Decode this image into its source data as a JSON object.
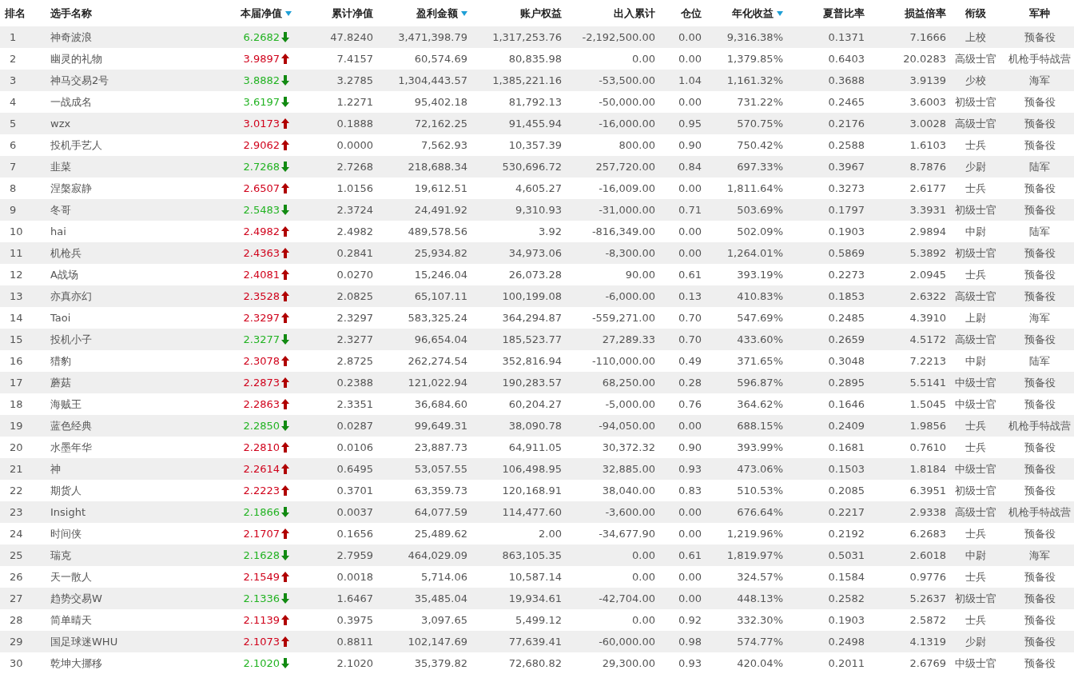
{
  "columns": [
    {
      "label": "排名",
      "sorted": false
    },
    {
      "label": "选手名称",
      "sorted": false
    },
    {
      "label": "本届净值",
      "sorted": true
    },
    {
      "label": "累计净值",
      "sorted": false
    },
    {
      "label": "盈利金额",
      "sorted": true
    },
    {
      "label": "账户权益",
      "sorted": false
    },
    {
      "label": "出入累计",
      "sorted": false
    },
    {
      "label": "仓位",
      "sorted": false
    },
    {
      "label": "年化收益",
      "sorted": true
    },
    {
      "label": "夏普比率",
      "sorted": false
    },
    {
      "label": "损益倍率",
      "sorted": false
    },
    {
      "label": "衔级",
      "sorted": false
    },
    {
      "label": "军种",
      "sorted": false
    }
  ],
  "rows": [
    {
      "kind": "down",
      "cells": [
        "1",
        "神奇波浪",
        "6.2682",
        "47.8240",
        "3,471,398.79",
        "1,317,253.76",
        "-2,192,500.00",
        "0.00",
        "9,316.38%",
        "0.1371",
        "7.1666",
        "上校",
        "预备役"
      ]
    },
    {
      "kind": "up",
      "cells": [
        "2",
        "幽灵的礼物",
        "3.9897",
        "7.4157",
        "60,574.69",
        "80,835.98",
        "0.00",
        "0.00",
        "1,379.85%",
        "0.6403",
        "20.0283",
        "高级士官",
        "机枪手特战营"
      ]
    },
    {
      "kind": "down",
      "cells": [
        "3",
        "神马交易2号",
        "3.8882",
        "3.2785",
        "1,304,443.57",
        "1,385,221.16",
        "-53,500.00",
        "1.04",
        "1,161.32%",
        "0.3688",
        "3.9139",
        "少校",
        "海军"
      ]
    },
    {
      "kind": "down",
      "cells": [
        "4",
        "一战成名",
        "3.6197",
        "1.2271",
        "95,402.18",
        "81,792.13",
        "-50,000.00",
        "0.00",
        "731.22%",
        "0.2465",
        "3.6003",
        "初级士官",
        "预备役"
      ]
    },
    {
      "kind": "up",
      "cells": [
        "5",
        "wzx",
        "3.0173",
        "0.1888",
        "72,162.25",
        "91,455.94",
        "-16,000.00",
        "0.95",
        "570.75%",
        "0.2176",
        "3.0028",
        "高级士官",
        "预备役"
      ]
    },
    {
      "kind": "up",
      "cells": [
        "6",
        "投机手艺人",
        "2.9062",
        "0.0000",
        "7,562.93",
        "10,357.39",
        "800.00",
        "0.90",
        "750.42%",
        "0.2588",
        "1.6103",
        "士兵",
        "预备役"
      ]
    },
    {
      "kind": "down",
      "cells": [
        "7",
        "韭菜",
        "2.7268",
        "2.7268",
        "218,688.34",
        "530,696.72",
        "257,720.00",
        "0.84",
        "697.33%",
        "0.3967",
        "8.7876",
        "少尉",
        "陆军"
      ]
    },
    {
      "kind": "up",
      "cells": [
        "8",
        "涅槃寂静",
        "2.6507",
        "1.0156",
        "19,612.51",
        "4,605.27",
        "-16,009.00",
        "0.00",
        "1,811.64%",
        "0.3273",
        "2.6177",
        "士兵",
        "预备役"
      ]
    },
    {
      "kind": "down",
      "cells": [
        "9",
        "冬哥",
        "2.5483",
        "2.3724",
        "24,491.92",
        "9,310.93",
        "-31,000.00",
        "0.71",
        "503.69%",
        "0.1797",
        "3.3931",
        "初级士官",
        "预备役"
      ]
    },
    {
      "kind": "up",
      "cells": [
        "10",
        "hai",
        "2.4982",
        "2.4982",
        "489,578.56",
        "3.92",
        "-816,349.00",
        "0.00",
        "502.09%",
        "0.1903",
        "2.9894",
        "中尉",
        "陆军"
      ]
    },
    {
      "kind": "up",
      "cells": [
        "11",
        "机枪兵",
        "2.4363",
        "0.2841",
        "25,934.82",
        "34,973.06",
        "-8,300.00",
        "0.00",
        "1,264.01%",
        "0.5869",
        "5.3892",
        "初级士官",
        "预备役"
      ]
    },
    {
      "kind": "up",
      "cells": [
        "12",
        "A战场",
        "2.4081",
        "0.0270",
        "15,246.04",
        "26,073.28",
        "90.00",
        "0.61",
        "393.19%",
        "0.2273",
        "2.0945",
        "士兵",
        "预备役"
      ]
    },
    {
      "kind": "up",
      "cells": [
        "13",
        "亦真亦幻",
        "2.3528",
        "2.0825",
        "65,107.11",
        "100,199.08",
        "-6,000.00",
        "0.13",
        "410.83%",
        "0.1853",
        "2.6322",
        "高级士官",
        "预备役"
      ]
    },
    {
      "kind": "up",
      "cells": [
        "14",
        "Taoi",
        "2.3297",
        "2.3297",
        "583,325.24",
        "364,294.87",
        "-559,271.00",
        "0.70",
        "547.69%",
        "0.2485",
        "4.3910",
        "上尉",
        "海军"
      ]
    },
    {
      "kind": "down",
      "cells": [
        "15",
        "投机小子",
        "2.3277",
        "2.3277",
        "96,654.04",
        "185,523.77",
        "27,289.33",
        "0.70",
        "433.60%",
        "0.2659",
        "4.5172",
        "高级士官",
        "预备役"
      ]
    },
    {
      "kind": "up",
      "cells": [
        "16",
        "猎豹",
        "2.3078",
        "2.8725",
        "262,274.54",
        "352,816.94",
        "-110,000.00",
        "0.49",
        "371.65%",
        "0.3048",
        "7.2213",
        "中尉",
        "陆军"
      ]
    },
    {
      "kind": "up",
      "cells": [
        "17",
        "蘑菇",
        "2.2873",
        "0.2388",
        "121,022.94",
        "190,283.57",
        "68,250.00",
        "0.28",
        "596.87%",
        "0.2895",
        "5.5141",
        "中级士官",
        "预备役"
      ]
    },
    {
      "kind": "up",
      "cells": [
        "18",
        "海贼王",
        "2.2863",
        "2.3351",
        "36,684.60",
        "60,204.27",
        "-5,000.00",
        "0.76",
        "364.62%",
        "0.1646",
        "1.5045",
        "中级士官",
        "预备役"
      ]
    },
    {
      "kind": "down",
      "cells": [
        "19",
        "蓝色经典",
        "2.2850",
        "0.0287",
        "99,649.31",
        "38,090.78",
        "-94,050.00",
        "0.00",
        "688.15%",
        "0.2409",
        "1.9856",
        "士兵",
        "机枪手特战营"
      ]
    },
    {
      "kind": "up",
      "cells": [
        "20",
        "水墨年华",
        "2.2810",
        "0.0106",
        "23,887.73",
        "64,911.05",
        "30,372.32",
        "0.90",
        "393.99%",
        "0.1681",
        "0.7610",
        "士兵",
        "预备役"
      ]
    },
    {
      "kind": "up",
      "cells": [
        "21",
        "神",
        "2.2614",
        "0.6495",
        "53,057.55",
        "106,498.95",
        "32,885.00",
        "0.93",
        "473.06%",
        "0.1503",
        "1.8184",
        "中级士官",
        "预备役"
      ]
    },
    {
      "kind": "up",
      "cells": [
        "22",
        "期货人",
        "2.2223",
        "0.3701",
        "63,359.73",
        "120,168.91",
        "38,040.00",
        "0.83",
        "510.53%",
        "0.2085",
        "6.3951",
        "初级士官",
        "预备役"
      ]
    },
    {
      "kind": "down",
      "cells": [
        "23",
        "Insight",
        "2.1866",
        "0.0037",
        "64,077.59",
        "114,477.60",
        "-3,600.00",
        "0.00",
        "676.64%",
        "0.2217",
        "2.9338",
        "高级士官",
        "机枪手特战营"
      ]
    },
    {
      "kind": "up",
      "cells": [
        "24",
        "时间侠",
        "2.1707",
        "0.1656",
        "25,489.62",
        "2.00",
        "-34,677.90",
        "0.00",
        "1,219.96%",
        "0.2192",
        "6.2683",
        "士兵",
        "预备役"
      ]
    },
    {
      "kind": "down",
      "cells": [
        "25",
        "瑞克",
        "2.1628",
        "2.7959",
        "464,029.09",
        "863,105.35",
        "0.00",
        "0.61",
        "1,819.97%",
        "0.5031",
        "2.6018",
        "中尉",
        "海军"
      ]
    },
    {
      "kind": "up",
      "cells": [
        "26",
        "天一散人",
        "2.1549",
        "0.0018",
        "5,714.06",
        "10,587.14",
        "0.00",
        "0.00",
        "324.57%",
        "0.1584",
        "0.9776",
        "士兵",
        "预备役"
      ]
    },
    {
      "kind": "down",
      "cells": [
        "27",
        "趋势交易W",
        "2.1336",
        "1.6467",
        "35,485.04",
        "19,934.61",
        "-42,704.00",
        "0.00",
        "448.13%",
        "0.2582",
        "5.2637",
        "初级士官",
        "预备役"
      ]
    },
    {
      "kind": "up",
      "cells": [
        "28",
        "简单晴天",
        "2.1139",
        "0.3975",
        "3,097.65",
        "5,499.12",
        "0.00",
        "0.92",
        "332.30%",
        "0.1903",
        "2.5872",
        "士兵",
        "预备役"
      ]
    },
    {
      "kind": "up",
      "cells": [
        "29",
        "国足球迷WHU",
        "2.1073",
        "0.8811",
        "102,147.69",
        "77,639.41",
        "-60,000.00",
        "0.98",
        "574.77%",
        "0.2498",
        "4.1319",
        "少尉",
        "预备役"
      ]
    },
    {
      "kind": "down",
      "cells": [
        "30",
        "乾坤大挪移",
        "2.1020",
        "2.1020",
        "35,379.82",
        "72,680.82",
        "29,300.00",
        "0.93",
        "420.04%",
        "0.2011",
        "2.6769",
        "中级士官",
        "预备役"
      ]
    }
  ]
}
